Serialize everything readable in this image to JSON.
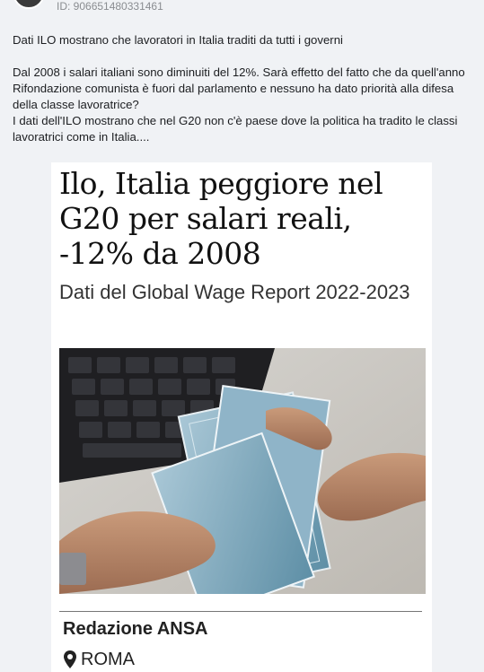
{
  "post": {
    "id_text": "ID: 906651480331461",
    "lines": [
      "Dati ILO mostrano che lavoratori in Italia traditi da tutti i governi",
      "",
      "Dal 2008 i salari italiani sono diminuiti del 12%. Sarà effetto del fatto che da quell'anno Rifondazione comunista è fuori dal parlamento e nessuno ha dato priorità alla difesa della classe lavoratrice?",
      "I dati dell'ILO mostrano che nel G20 non c'è paese dove la politica ha tradito le classi lavoratrici come in Italia...."
    ]
  },
  "article": {
    "headline": "Ilo, Italia peggiore nel G20 per salari reali, -12% da 2008",
    "subtitle": "Dati del Global Wage Report 2022-2023",
    "photo_icon": "euro-banknotes-photo",
    "byline": "Redazione ANSA",
    "location_icon": "map-pin-icon",
    "location": "ROMA"
  }
}
